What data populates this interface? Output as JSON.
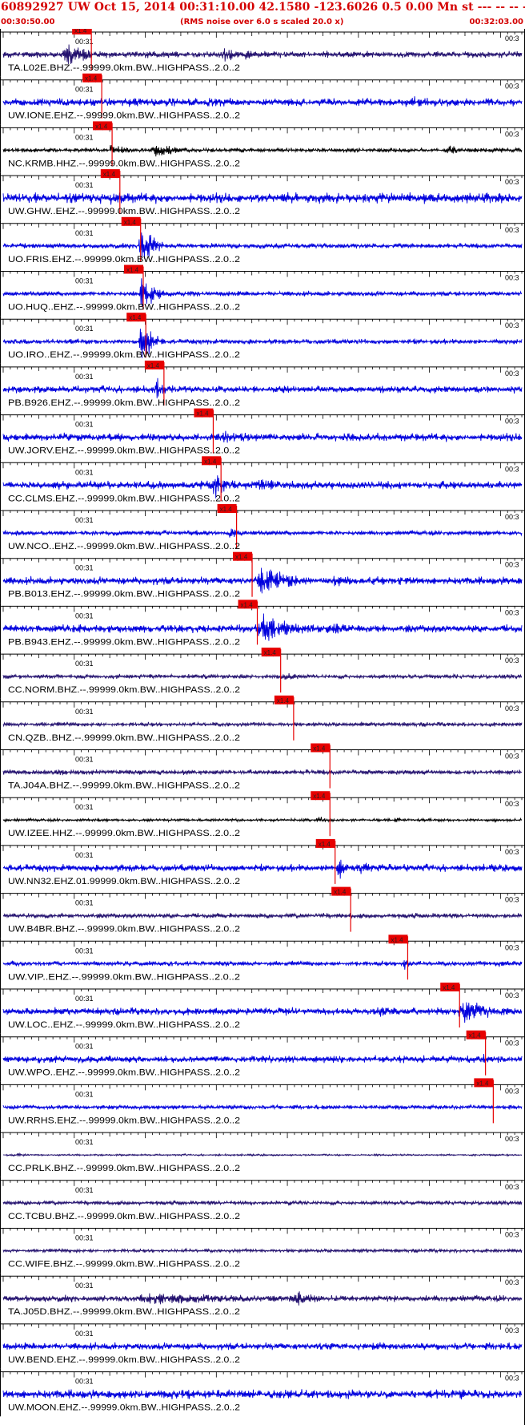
{
  "header": {
    "title": "60892927 UW Oct 15, 2014 00:31:10.00   42.1580 -123.6026  0.5 0.00 Mn st --- -- --  -1",
    "start_time": "00:30:50.00",
    "scale_note": "(RMS noise over 6.0 s scaled 20.0 x)",
    "end_time": "00:32:03.00"
  },
  "chart_data": {
    "type": "line",
    "title": "60892927 UW Oct 15, 2014 00:31:10.00   42.1580 -123.6026  0.5 0.00 Mn st --- -- --  -1",
    "subtitle": "(RMS noise over 6.0 s scaled 20.0 x)",
    "x_range": [
      "00:30:50.00",
      "00:32:03.00"
    ],
    "time_tick_label": "00:31",
    "right_tick_label": "00:3",
    "pick_label": "x1.4",
    "colors": {
      "blue": "#0000dd",
      "dark": "#22106e",
      "black": "#000000",
      "pick": "#e60000"
    },
    "series": [
      {
        "label": "TA.L02E.BHZ.--.99999.0km.BW..HIGHPASS..2.0..2",
        "color": "dark",
        "pick": 0.17,
        "env": [
          [
            0.11,
            0.21,
            1.0
          ],
          [
            0.42,
            0.46,
            0.9
          ],
          [
            0.46,
            0.52,
            0.5
          ]
        ],
        "noise": 0.18
      },
      {
        "label": "UW.IONE.EHZ.--.99999.0km.BW..HIGHPASS..2.0..2",
        "color": "blue",
        "pick": 0.19,
        "env": [
          [
            0.78,
            0.85,
            0.5
          ],
          [
            0.93,
            0.97,
            0.45
          ]
        ],
        "noise": 0.22
      },
      {
        "label": "NC.KRMB.HHZ.--.99999.0km.BW..HIGHPASS..2.0..2",
        "color": "black",
        "pick": 0.21,
        "env": [
          [
            0.2,
            0.27,
            0.6
          ],
          [
            0.28,
            0.38,
            0.55
          ],
          [
            0.85,
            0.92,
            0.45
          ]
        ],
        "noise": 0.12
      },
      {
        "label": "UW.GHW..EHZ.--.99999.0km.BW..HIGHPASS..2.0..2",
        "color": "blue",
        "pick": 0.225,
        "env": [
          [
            0.2,
            0.25,
            0.8
          ],
          [
            0.78,
            0.8,
            0.6
          ],
          [
            0.95,
            1.0,
            0.4
          ]
        ],
        "noise": 0.28
      },
      {
        "label": "UO.FRIS.EHZ.--.99999.0km.BW..HIGHPASS..2.0..2",
        "color": "blue",
        "pick": 0.265,
        "env": [
          [
            0.26,
            0.31,
            1.8
          ]
        ],
        "noise": 0.14
      },
      {
        "label": "UO.HUQ..EHZ.--.99999.0km.BW..HIGHPASS..2.0..2",
        "color": "blue",
        "pick": 0.27,
        "env": [
          [
            0.26,
            0.31,
            1.8
          ]
        ],
        "noise": 0.14
      },
      {
        "label": "UO.IRO..EHZ.--.99999.0km.BW..HIGHPASS..2.0..2",
        "color": "blue",
        "pick": 0.275,
        "env": [
          [
            0.26,
            0.31,
            1.8
          ]
        ],
        "noise": 0.14
      },
      {
        "label": "PB.B926.EHZ.--.99999.0km.BW..HIGHPASS..2.0..2",
        "color": "blue",
        "pick": 0.31,
        "env": [
          [
            0.29,
            0.33,
            0.9
          ]
        ],
        "noise": 0.2
      },
      {
        "label": "UW.JORV.EHZ.--.99999.0km.BW..HIGHPASS..2.0..2",
        "color": "blue",
        "pick": 0.405,
        "env": [
          [
            0.39,
            0.62,
            0.5
          ]
        ],
        "noise": 0.22
      },
      {
        "label": "CC.CLMS.EHZ.--.99999.0km.BW..HIGHPASS..2.0..2",
        "color": "blue",
        "pick": 0.42,
        "env": [
          [
            0.4,
            0.46,
            1.1
          ],
          [
            0.46,
            0.72,
            0.45
          ]
        ],
        "noise": 0.22
      },
      {
        "label": "UW.NCO..EHZ.--.99999.0km.BW..HIGHPASS..2.0..2",
        "color": "blue",
        "pick": 0.45,
        "env": [
          [
            0.43,
            0.47,
            0.6
          ]
        ],
        "noise": 0.14
      },
      {
        "label": "PB.B013.EHZ.--.99999.0km.BW..HIGHPASS..2.0..2",
        "color": "blue",
        "pick": 0.48,
        "env": [
          [
            0.48,
            0.62,
            1.2
          ],
          [
            0.62,
            0.75,
            0.5
          ]
        ],
        "noise": 0.22
      },
      {
        "label": "PB.B943.EHZ.--.99999.0km.BW..HIGHPASS..2.0..2",
        "color": "blue",
        "pick": 0.49,
        "env": [
          [
            0.48,
            0.62,
            1.2
          ],
          [
            0.62,
            0.75,
            0.5
          ]
        ],
        "noise": 0.22
      },
      {
        "label": "CC.NORM.BHZ.--.99999.0km.BW..HIGHPASS..2.0..2",
        "color": "dark",
        "pick": 0.535,
        "env": [
          [
            0.53,
            0.62,
            0.35
          ]
        ],
        "noise": 0.12
      },
      {
        "label": "CN.QZB..BHZ.--.99999.0km.BW..HIGHPASS..2.0..2",
        "color": "dark",
        "pick": 0.56,
        "env": [],
        "noise": 0.12
      },
      {
        "label": "TA.J04A.BHZ.--.99999.0km.BW..HIGHPASS..2.0..2",
        "color": "dark",
        "pick": 0.63,
        "env": [
          [
            0.05,
            0.5,
            0.22
          ]
        ],
        "noise": 0.14
      },
      {
        "label": "UW.IZEE.HHZ.--.99999.0km.BW..HIGHPASS..2.0..2",
        "color": "black",
        "pick": 0.63,
        "env": [
          [
            0.6,
            0.66,
            0.3
          ],
          [
            0.75,
            0.79,
            0.25
          ]
        ],
        "noise": 0.08
      },
      {
        "label": "UW.NN32.EHZ.01.99999.0km.BW..HIGHPASS..2.0..2",
        "color": "blue",
        "pick": 0.64,
        "env": [
          [
            0.64,
            0.67,
            1.2
          ],
          [
            0.67,
            0.8,
            0.45
          ]
        ],
        "noise": 0.2
      },
      {
        "label": "UW.B4BR.BHZ.--.99999.0km.BW..HIGHPASS..2.0..2",
        "color": "dark",
        "pick": 0.67,
        "env": [],
        "noise": 0.14
      },
      {
        "label": "UW.VIP..EHZ.--.99999.0km.BW..HIGHPASS..2.0..2",
        "color": "blue",
        "pick": 0.78,
        "env": [
          [
            0.77,
            0.8,
            0.7
          ],
          [
            0.95,
            1.0,
            0.4
          ]
        ],
        "noise": 0.14
      },
      {
        "label": "UW.LOC..EHZ.--.99999.0km.BW..HIGHPASS..2.0..2",
        "color": "blue",
        "pick": 0.88,
        "env": [
          [
            0.7,
            0.87,
            0.4
          ],
          [
            0.87,
            1.0,
            1.0
          ]
        ],
        "noise": 0.2
      },
      {
        "label": "UW.WPO..EHZ.--.99999.0km.BW..HIGHPASS..2.0..2",
        "color": "blue",
        "pick": 0.93,
        "env": [
          [
            0.14,
            0.2,
            0.35
          ],
          [
            0.92,
            0.95,
            0.6
          ]
        ],
        "noise": 0.2
      },
      {
        "label": "UW.RRHS.EHZ.--.99999.0km.BW..HIGHPASS..2.0..2",
        "color": "blue",
        "pick": 0.945,
        "env": [
          [
            0.76,
            0.78,
            0.4
          ]
        ],
        "noise": 0.12
      },
      {
        "label": "CC.PRLK.BHZ.--.99999.0km.BW..HIGHPASS..2.0..2",
        "color": "dark",
        "pick": null,
        "env": [
          [
            0.02,
            0.07,
            0.15
          ]
        ],
        "noise": 0.05
      },
      {
        "label": "CC.TCBU.BHZ.--.99999.0km.BW..HIGHPASS..2.0..2",
        "color": "dark",
        "pick": null,
        "env": [],
        "noise": 0.12
      },
      {
        "label": "CC.WIFE.BHZ.--.99999.0km.BW..HIGHPASS..2.0..2",
        "color": "dark",
        "pick": null,
        "env": [],
        "noise": 0.1
      },
      {
        "label": "TA.J05D.BHZ.--.99999.0km.BW..HIGHPASS..2.0..2",
        "color": "dark",
        "pick": null,
        "env": [
          [
            0.2,
            0.8,
            0.45
          ],
          [
            0.55,
            0.65,
            0.6
          ]
        ],
        "noise": 0.18
      },
      {
        "label": "UW.BEND.EHZ.--.99999.0km.BW..HIGHPASS..2.0..2",
        "color": "blue",
        "pick": null,
        "env": [
          [
            0.7,
            0.8,
            0.3
          ]
        ],
        "noise": 0.2
      },
      {
        "label": "UW.MOON.EHZ.--.99999.0km.BW..HIGHPASS..2.0..2",
        "color": "blue",
        "pick": null,
        "env": [],
        "noise": 0.25
      }
    ]
  }
}
